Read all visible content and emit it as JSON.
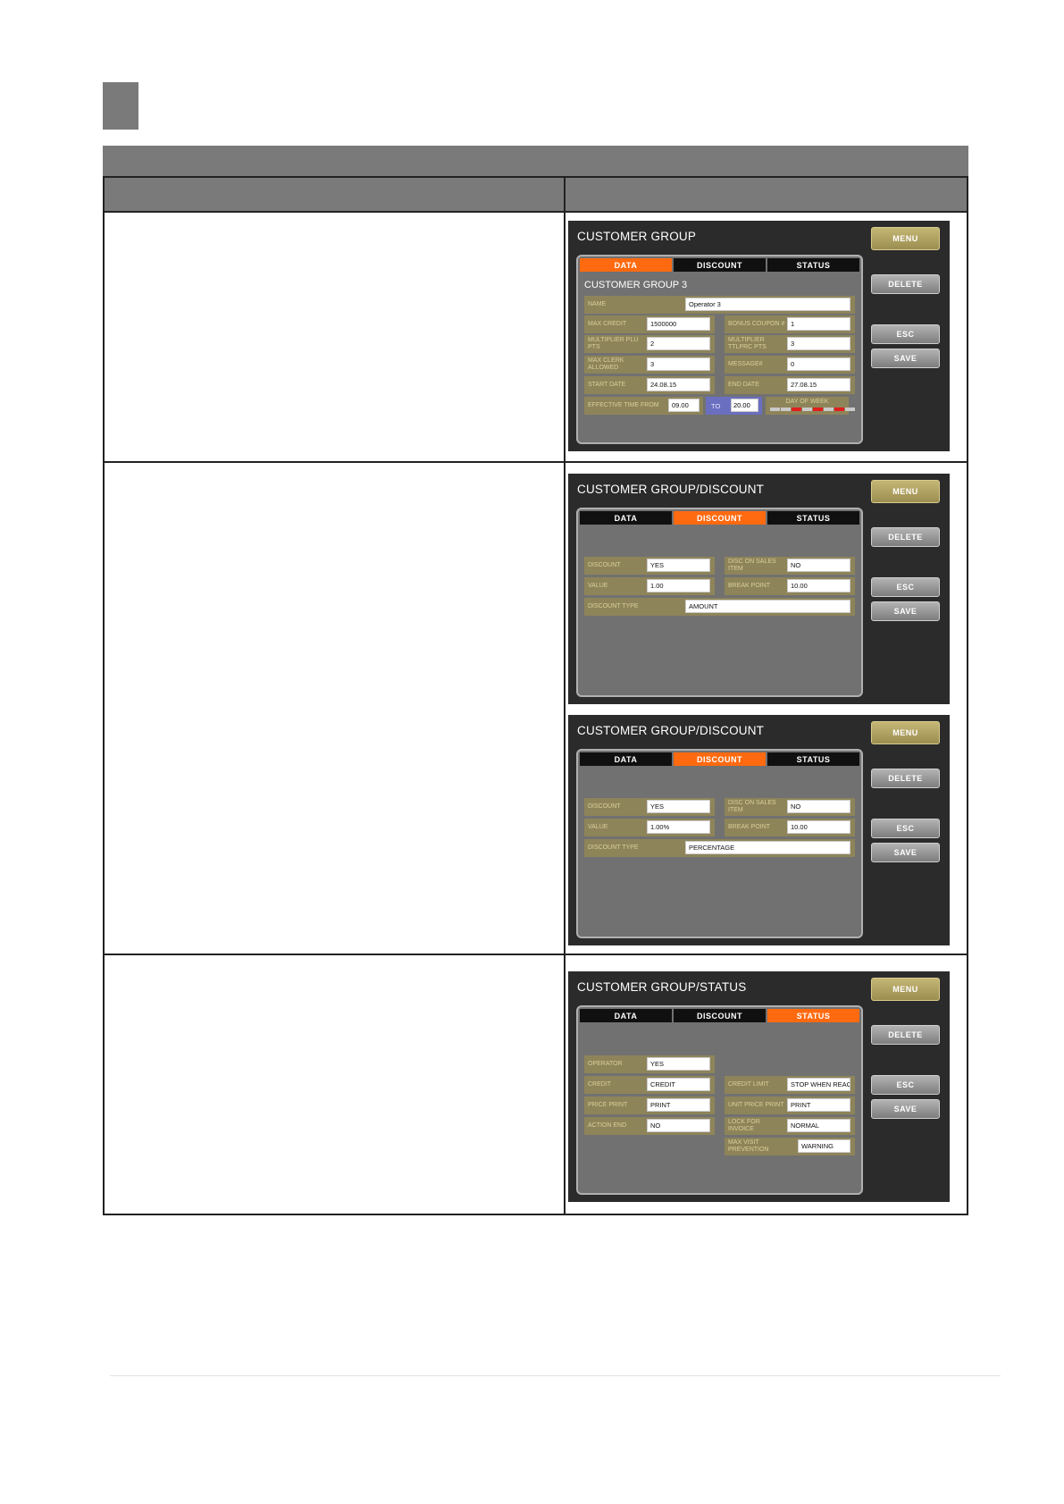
{
  "screens": [
    {
      "title": "CUSTOMER GROUP",
      "tabs": [
        "DATA",
        "DISCOUNT",
        "STATUS"
      ],
      "active_tab": "DATA",
      "panel_heading": "CUSTOMER GROUP 3",
      "buttons": {
        "menu": "MENU",
        "delete": "DELETE",
        "esc": "ESC",
        "save": "SAVE"
      },
      "fields": {
        "name": {
          "label": "NAME",
          "value": "Operator 3"
        },
        "max_credit": {
          "label": "MAX CREDIT",
          "value": "1500000"
        },
        "bonus_coupon": {
          "label": "BONUS COUPON #",
          "value": "1"
        },
        "multiplier_plu": {
          "label": "MULTIPLIER PLU PTS",
          "value": "2"
        },
        "multiplier_ttl": {
          "label": "MULTIPLIER TTLPRC PTS",
          "value": "3"
        },
        "max_clerk": {
          "label": "MAX CLERK ALLOWED",
          "value": "3"
        },
        "messages": {
          "label": "MESSAGE#",
          "value": "0"
        },
        "start_date": {
          "label": "START DATE",
          "value": "24.08.15"
        },
        "end_date": {
          "label": "END DATE",
          "value": "27.08.15"
        },
        "effective_time_from": {
          "label": "EFFECTIVE TIME FROM",
          "value": "09.00"
        },
        "to": {
          "label": "TO",
          "value": "20.00"
        },
        "day_of_week": {
          "label": "DAY OF WEEK",
          "days_on": [
            false,
            false,
            true,
            false,
            true,
            false,
            true,
            false
          ]
        }
      }
    },
    {
      "title": "CUSTOMER GROUP/DISCOUNT",
      "tabs": [
        "DATA",
        "DISCOUNT",
        "STATUS"
      ],
      "active_tab": "DISCOUNT",
      "buttons": {
        "menu": "MENU",
        "delete": "DELETE",
        "esc": "ESC",
        "save": "SAVE"
      },
      "fields": {
        "discount": {
          "label": "DISCOUNT",
          "value": "YES"
        },
        "disc_on_sales": {
          "label": "DISC ON SALES ITEM",
          "value": "NO"
        },
        "value": {
          "label": "VALUE",
          "value": "1.00"
        },
        "break_point": {
          "label": "BREAK POINT",
          "value": "10.00"
        },
        "discount_type": {
          "label": "DISCOUNT TYPE",
          "value": "AMOUNT"
        }
      }
    },
    {
      "title": "CUSTOMER GROUP/DISCOUNT",
      "tabs": [
        "DATA",
        "DISCOUNT",
        "STATUS"
      ],
      "active_tab": "DISCOUNT",
      "buttons": {
        "menu": "MENU",
        "delete": "DELETE",
        "esc": "ESC",
        "save": "SAVE"
      },
      "fields": {
        "discount": {
          "label": "DISCOUNT",
          "value": "YES"
        },
        "disc_on_sales": {
          "label": "DISC ON SALES ITEM",
          "value": "NO"
        },
        "value": {
          "label": "VALUE",
          "value": "1.00%"
        },
        "break_point": {
          "label": "BREAK POINT",
          "value": "10.00"
        },
        "discount_type": {
          "label": "DISCOUNT TYPE",
          "value": "PERCENTAGE"
        }
      }
    },
    {
      "title": "CUSTOMER GROUP/STATUS",
      "tabs": [
        "DATA",
        "DISCOUNT",
        "STATUS"
      ],
      "active_tab": "STATUS",
      "buttons": {
        "menu": "MENU",
        "delete": "DELETE",
        "esc": "ESC",
        "save": "SAVE"
      },
      "fields": {
        "operator": {
          "label": "OPERATOR",
          "value": "YES"
        },
        "credit": {
          "label": "CREDIT",
          "value": "CREDIT"
        },
        "credit_limit": {
          "label": "CREDIT LIMIT",
          "value": "STOP WHEN REACH"
        },
        "price_print": {
          "label": "PRICE PRINT",
          "value": "PRINT"
        },
        "unit_price_print": {
          "label": "UNIT PRICE PRINT",
          "value": "PRINT"
        },
        "action_end": {
          "label": "ACTION END",
          "value": "NO"
        },
        "lock_for_invoice": {
          "label": "LOCK FOR INVOICE",
          "value": "NORMAL"
        },
        "max_visit_prevention": {
          "label": "MAX VISIT PREVENTION",
          "value": "WARNING"
        }
      }
    }
  ],
  "colors": {
    "active_tab": "#ff6a10",
    "menu_button": "#b0a262",
    "field_label_bg": "#8e8459",
    "header_bar": "#7a7a7a",
    "screen_bg": "#2b2b2b"
  }
}
